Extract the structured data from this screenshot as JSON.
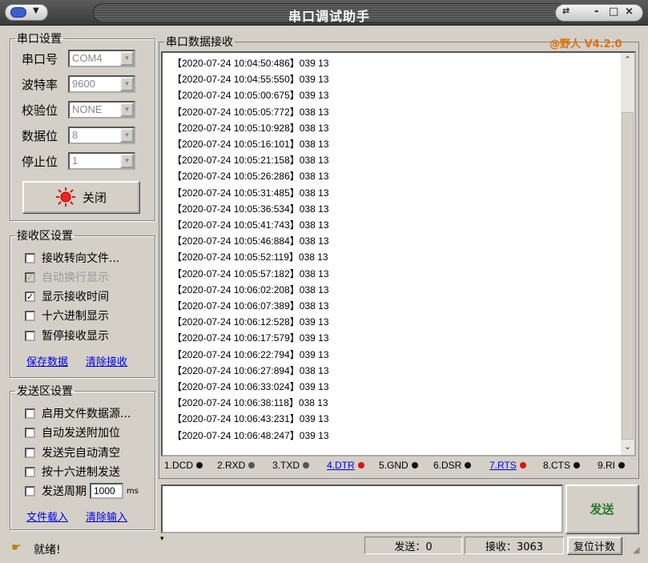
{
  "window": {
    "title": "串口调试助手",
    "controls": [
      "-",
      "□",
      "×"
    ]
  },
  "port_settings": {
    "legend": "串口设置",
    "fields": [
      {
        "label": "串口号",
        "value": "COM4"
      },
      {
        "label": "波特率",
        "value": "9600"
      },
      {
        "label": "校验位",
        "value": "NONE"
      },
      {
        "label": "数据位",
        "value": "8"
      },
      {
        "label": "停止位",
        "value": "1"
      }
    ],
    "close_button": "关闭"
  },
  "receive_settings": {
    "legend": "接收区设置",
    "options": [
      {
        "label": "接收转向文件...",
        "checked": false,
        "enabled": true
      },
      {
        "label": "自动换行显示",
        "checked": true,
        "enabled": false
      },
      {
        "label": "显示接收时间",
        "checked": true,
        "enabled": true
      },
      {
        "label": "十六进制显示",
        "checked": false,
        "enabled": true
      },
      {
        "label": "暂停接收显示",
        "checked": false,
        "enabled": true
      }
    ],
    "save_link": "保存数据",
    "clear_link": "清除接收"
  },
  "send_settings": {
    "legend": "发送区设置",
    "options": [
      {
        "label": "启用文件数据源...",
        "checked": false
      },
      {
        "label": "自动发送附加位",
        "checked": false
      },
      {
        "label": "发送完自动清空",
        "checked": false
      },
      {
        "label": "按十六进制发送",
        "checked": false
      }
    ],
    "period_label": "发送周期",
    "period_value": "1000",
    "period_unit": "ms",
    "load_link": "文件载入",
    "clear_link": "清除输入"
  },
  "receive_area": {
    "legend": "串口数据接收",
    "brand": "@野人 V4.2.0",
    "lines": [
      "【2020-07-24 10:04:50:486】039 13",
      "【2020-07-24 10:04:55:550】039 13",
      "【2020-07-24 10:05:00:675】039 13",
      "【2020-07-24 10:05:05:772】038 13",
      "【2020-07-24 10:05:10:928】038 13",
      "【2020-07-24 10:05:16:101】038 13",
      "【2020-07-24 10:05:21:158】038 13",
      "【2020-07-24 10:05:26:286】038 13",
      "【2020-07-24 10:05:31:485】038 13",
      "【2020-07-24 10:05:36:534】038 13",
      "【2020-07-24 10:05:41:743】038 13",
      "【2020-07-24 10:05:46:884】038 13",
      "【2020-07-24 10:05:52:119】038 13",
      "【2020-07-24 10:05:57:182】038 13",
      "【2020-07-24 10:06:02:208】038 13",
      "【2020-07-24 10:06:07:389】038 13",
      "【2020-07-24 10:06:12:528】039 13",
      "【2020-07-24 10:06:17:579】039 13",
      "【2020-07-24 10:06:22:794】039 13",
      "【2020-07-24 10:06:27:894】038 13",
      "【2020-07-24 10:06:33:024】039 13",
      "【2020-07-24 10:06:38:118】038 13",
      "【2020-07-24 10:06:43:231】039 13",
      "【2020-07-24 10:06:48:247】039 13"
    ]
  },
  "signals": [
    {
      "label": "1.DCD",
      "color": "#111111",
      "link": false
    },
    {
      "label": "2.RXD",
      "color": "#555555",
      "link": false
    },
    {
      "label": "3.TXD",
      "color": "#555555",
      "link": false
    },
    {
      "label": "4.DTR",
      "color": "#e01010",
      "link": true
    },
    {
      "label": "5.GND",
      "color": "#111111",
      "link": false
    },
    {
      "label": "6.DSR",
      "color": "#111111",
      "link": false
    },
    {
      "label": "7.RTS",
      "color": "#e01010",
      "link": true
    },
    {
      "label": "8.CTS",
      "color": "#111111",
      "link": false
    },
    {
      "label": "9.RI",
      "color": "#111111",
      "link": false
    }
  ],
  "send_button": "发送",
  "status": {
    "ready": "就绪!",
    "sent": "发送：0",
    "received": "接收：3063",
    "reset": "复位计数"
  },
  "colors": {
    "brand": "#e07000",
    "send_green": "#2a7a2a",
    "link_blue": "#0000ee",
    "led_red": "#e01010"
  }
}
